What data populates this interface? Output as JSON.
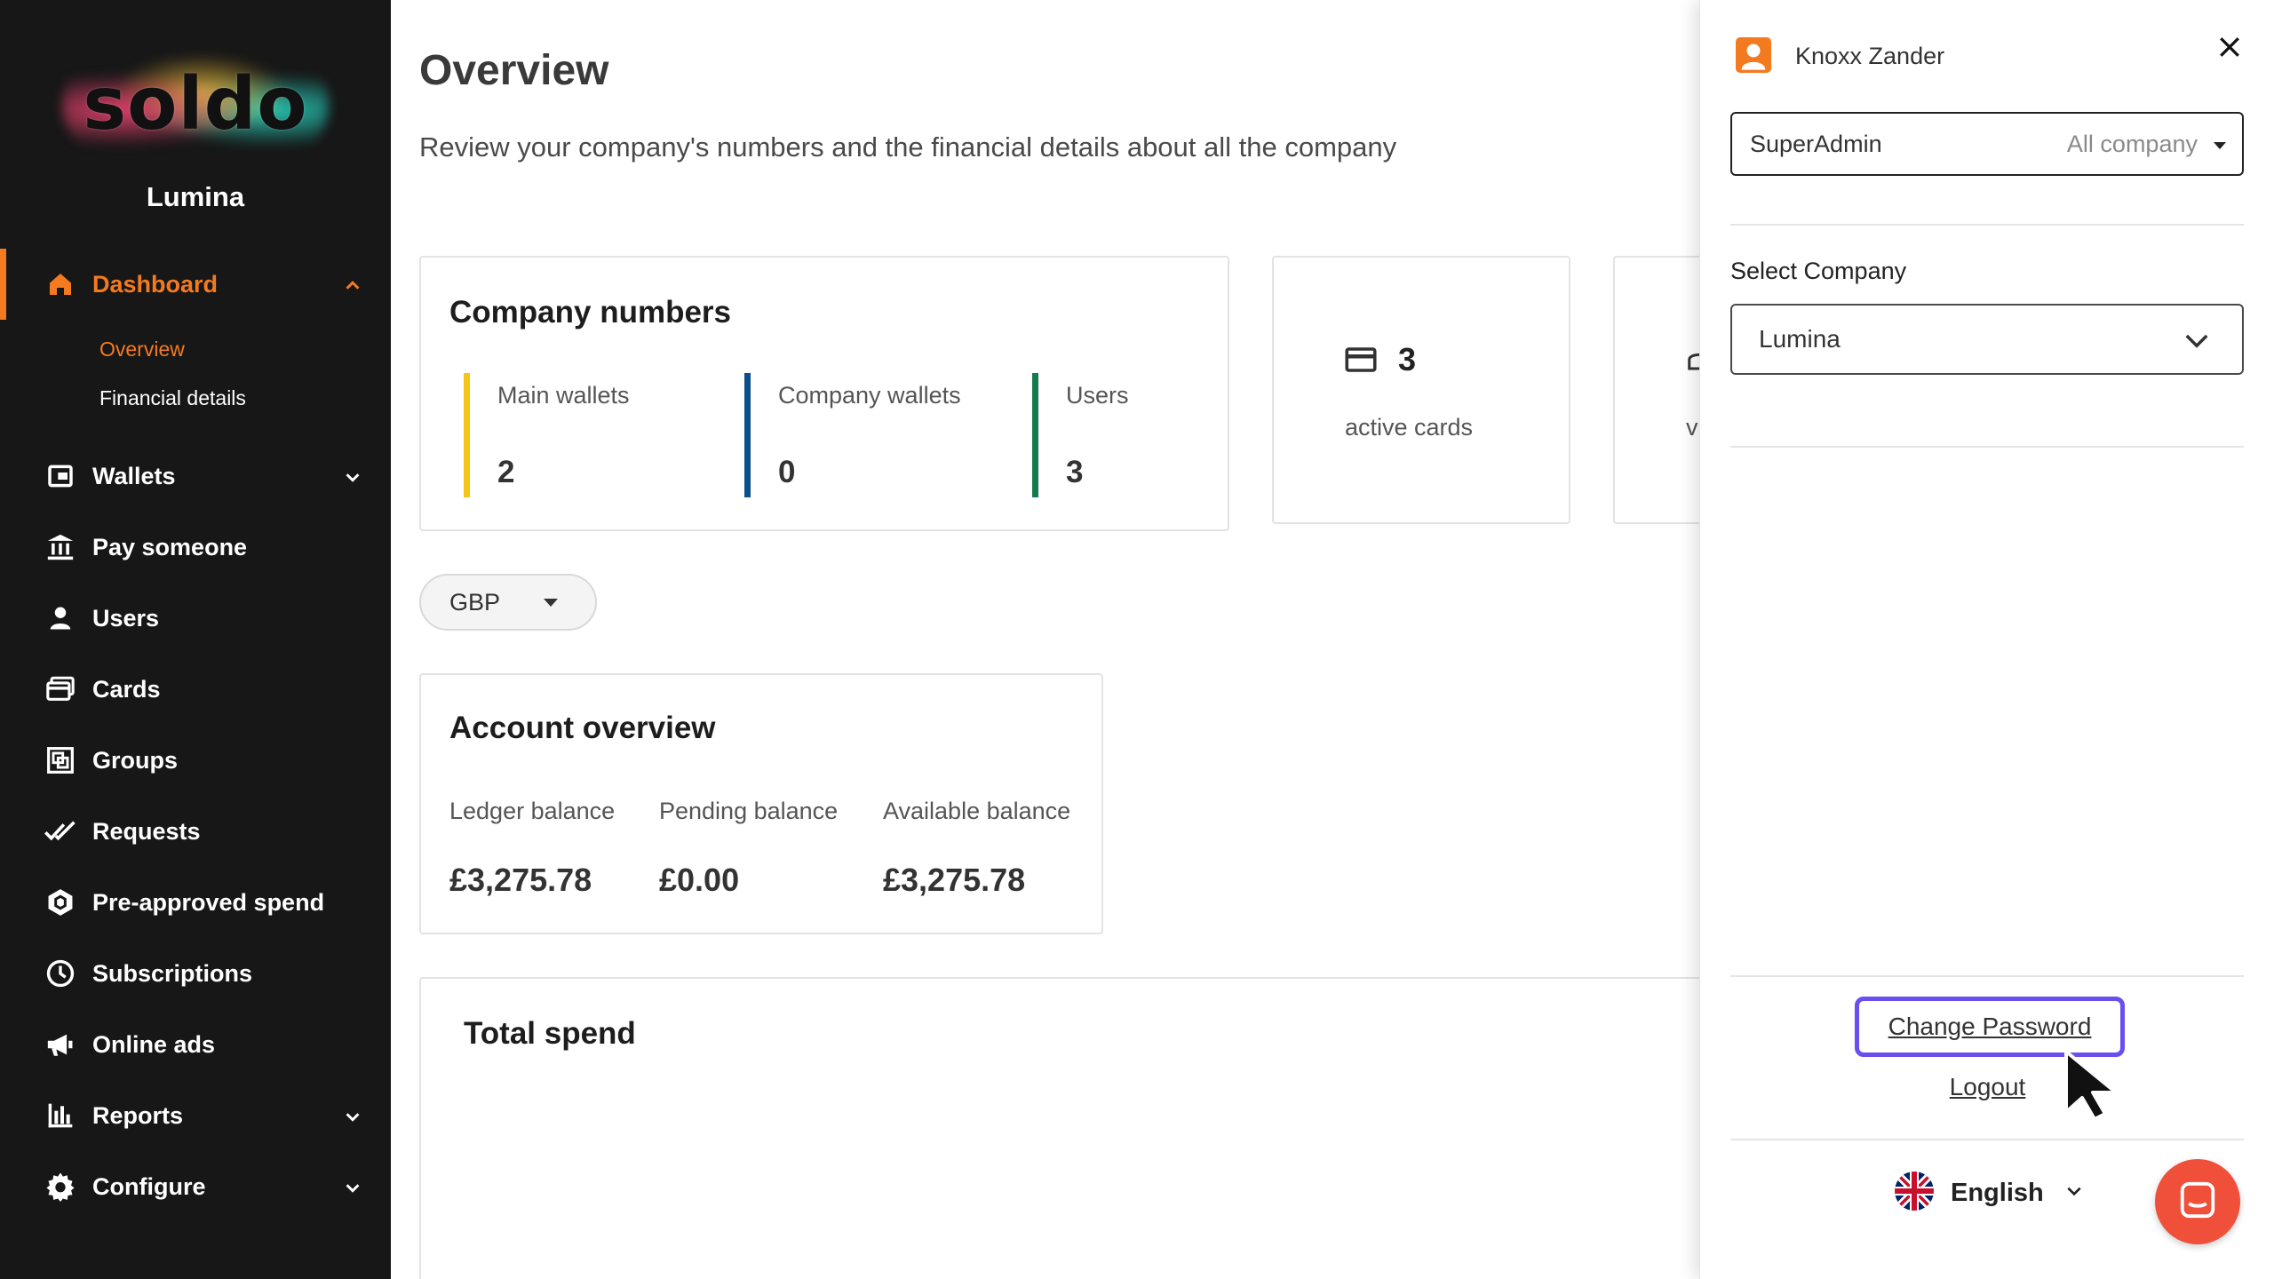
{
  "brand": {
    "logo_text": "soldo",
    "company": "Lumina"
  },
  "sidebar": {
    "items": [
      {
        "label": "Dashboard",
        "icon": "home-icon"
      },
      {
        "label": "Wallets",
        "icon": "wallet-icon"
      },
      {
        "label": "Pay someone",
        "icon": "bank-icon"
      },
      {
        "label": "Users",
        "icon": "user-icon"
      },
      {
        "label": "Cards",
        "icon": "cards-icon"
      },
      {
        "label": "Groups",
        "icon": "groups-icon"
      },
      {
        "label": "Requests",
        "icon": "check-icon"
      },
      {
        "label": "Pre-approved spend",
        "icon": "hexagon-icon"
      },
      {
        "label": "Subscriptions",
        "icon": "clock-icon"
      },
      {
        "label": "Online ads",
        "icon": "megaphone-icon"
      },
      {
        "label": "Reports",
        "icon": "bar-chart-icon"
      },
      {
        "label": "Configure",
        "icon": "gear-icon"
      }
    ],
    "dashboard_sub": [
      "Overview",
      "Financial details"
    ]
  },
  "main": {
    "title": "Overview",
    "subtitle": "Review your company's numbers and the financial details about all the company",
    "company_numbers": {
      "title": "Company numbers",
      "metrics": [
        {
          "label": "Main wallets",
          "value": "2",
          "color": "#f5c518"
        },
        {
          "label": "Company wallets",
          "value": "0",
          "color": "#0d4f8b"
        },
        {
          "label": "Users",
          "value": "3",
          "color": "#157a4f"
        }
      ]
    },
    "active_cards": {
      "value": "3",
      "label": "active cards"
    },
    "partial_card_letter": "v",
    "currency": "GBP",
    "account_overview": {
      "title": "Account overview",
      "balances": [
        {
          "label": "Ledger balance",
          "value": "£3,275.78"
        },
        {
          "label": "Pending balance",
          "value": "£0.00"
        },
        {
          "label": "Available balance",
          "value": "£3,275.78"
        }
      ]
    },
    "total_spend_title": "Total spend"
  },
  "panel": {
    "user_name": "Knoxx Zander",
    "role": "SuperAdmin",
    "role_scope": "All company",
    "select_company_label": "Select Company",
    "company": "Lumina",
    "change_password": "Change Password",
    "logout": "Logout",
    "language": "English",
    "accent": "#6a4ff0",
    "chat_color": "#f0503a"
  }
}
